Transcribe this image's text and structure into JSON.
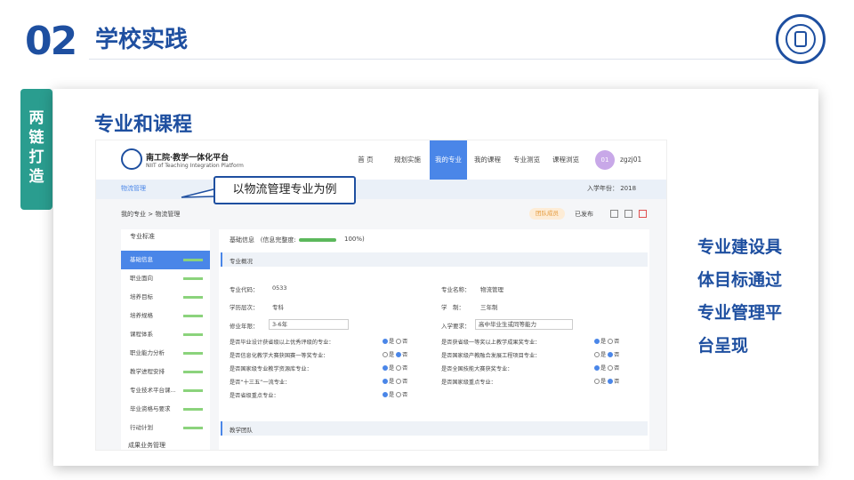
{
  "header": {
    "number": "02",
    "title": "学校实践"
  },
  "side_tag": [
    "两",
    "链",
    "打",
    "造"
  ],
  "panel_title": "专业和课程",
  "callout": "以物流管理专业为例",
  "right_text": [
    "专业建设具",
    "体目标通过",
    "专业管理平",
    "台呈现"
  ],
  "app": {
    "name": "南工院·教学一体化平台",
    "sub": "NIIT of Teaching Integration Platform",
    "nav": [
      "首 页",
      "规划实施",
      "我的专业",
      "我的课程",
      "专业测览",
      "课程浏览"
    ],
    "nav_active": 2,
    "avatar": "01",
    "user": "zgzj01",
    "sub_left": "物流管理",
    "sub_right": "入学年份： 2018",
    "breadcrumb": "我的专业 > 物流管理",
    "tag": "团队成员",
    "publish": "已发布",
    "left_head": "专业标准",
    "left_items": [
      "基础信息",
      "职业面向",
      "培养目标",
      "培养规格",
      "课程体系",
      "职业能力分析",
      "教学进程安排",
      "专业技术平台课...",
      "毕业资格与要求",
      "行动计划"
    ],
    "left_foot": "成果业务管理",
    "base_info": "基础信息",
    "completeness": "(信息完整度:",
    "completeness_pct": "100%)",
    "section1": "专业概况",
    "code_label": "专业代码：",
    "code": "0533",
    "name_label": "专业名称：",
    "name_val": "物流管理",
    "level_label": "学历层次：",
    "level": "专科",
    "system_label": "学　制：",
    "system": "三年制",
    "years_label": "修业年限：",
    "years": "3-6年",
    "req_label": "入学要求：",
    "req": "高中毕业生或同等能力",
    "questions_left": [
      {
        "q": "是否毕业设计获省级以上优秀评级的专业：",
        "yes": true
      },
      {
        "q": "是否信息化教学大赛获国赛一等奖专业：",
        "yes": false
      },
      {
        "q": "是否国家级专业教学资源库专业：",
        "yes": true
      },
      {
        "q": "是否“十三五”一流专业：",
        "yes": true
      },
      {
        "q": "是否省级重点专业：",
        "yes": true
      }
    ],
    "questions_right": [
      {
        "q": "是否获省级一等奖以上教学成果奖专业：",
        "yes": true
      },
      {
        "q": "是否国家级产教融合发展工程项目专业：",
        "yes": false
      },
      {
        "q": "是否全国技能大赛获奖专业：",
        "yes": true
      },
      {
        "q": "是否国家级重点专业：",
        "yes": false
      }
    ],
    "yes_label": "是",
    "no_label": "否",
    "section2": "教学团队"
  }
}
